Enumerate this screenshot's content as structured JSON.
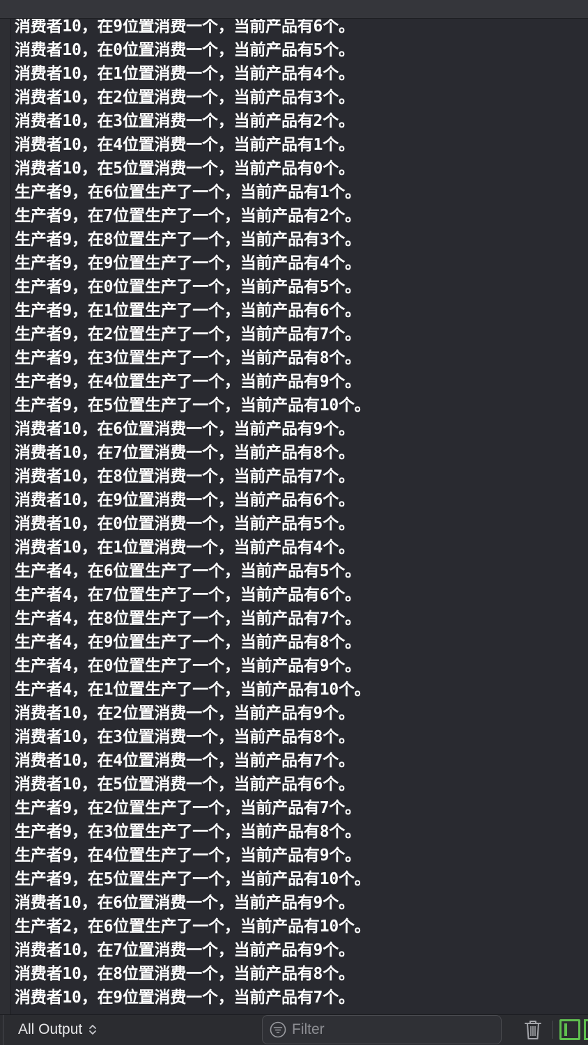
{
  "console": {
    "lines": [
      "消费者10，在9位置消费一个，当前产品有6个。",
      "消费者10，在0位置消费一个，当前产品有5个。",
      "消费者10，在1位置消费一个，当前产品有4个。",
      "消费者10，在2位置消费一个，当前产品有3个。",
      "消费者10，在3位置消费一个，当前产品有2个。",
      "消费者10，在4位置消费一个，当前产品有1个。",
      "消费者10，在5位置消费一个，当前产品有0个。",
      "生产者9，在6位置生产了一个，当前产品有1个。",
      "生产者9，在7位置生产了一个，当前产品有2个。",
      "生产者9，在8位置生产了一个，当前产品有3个。",
      "生产者9，在9位置生产了一个，当前产品有4个。",
      "生产者9，在0位置生产了一个，当前产品有5个。",
      "生产者9，在1位置生产了一个，当前产品有6个。",
      "生产者9，在2位置生产了一个，当前产品有7个。",
      "生产者9，在3位置生产了一个，当前产品有8个。",
      "生产者9，在4位置生产了一个，当前产品有9个。",
      "生产者9，在5位置生产了一个，当前产品有10个。",
      "消费者10，在6位置消费一个，当前产品有9个。",
      "消费者10，在7位置消费一个，当前产品有8个。",
      "消费者10，在8位置消费一个，当前产品有7个。",
      "消费者10，在9位置消费一个，当前产品有6个。",
      "消费者10，在0位置消费一个，当前产品有5个。",
      "消费者10，在1位置消费一个，当前产品有4个。",
      "生产者4，在6位置生产了一个，当前产品有5个。",
      "生产者4，在7位置生产了一个，当前产品有6个。",
      "生产者4，在8位置生产了一个，当前产品有7个。",
      "生产者4，在9位置生产了一个，当前产品有8个。",
      "生产者4，在0位置生产了一个，当前产品有9个。",
      "生产者4，在1位置生产了一个，当前产品有10个。",
      "消费者10，在2位置消费一个，当前产品有9个。",
      "消费者10，在3位置消费一个，当前产品有8个。",
      "消费者10，在4位置消费一个，当前产品有7个。",
      "消费者10，在5位置消费一个，当前产品有6个。",
      "生产者9，在2位置生产了一个，当前产品有7个。",
      "生产者9，在3位置生产了一个，当前产品有8个。",
      "生产者9，在4位置生产了一个，当前产品有9个。",
      "生产者9，在5位置生产了一个，当前产品有10个。",
      "消费者10，在6位置消费一个，当前产品有9个。",
      "生产者2，在6位置生产了一个，当前产品有10个。",
      "消费者10，在7位置消费一个，当前产品有9个。",
      "消费者10，在8位置消费一个，当前产品有8个。",
      "消费者10，在9位置消费一个，当前产品有7个。"
    ]
  },
  "bottombar": {
    "output_label": "All Output",
    "output_icon": "chevron-updown-icon",
    "filter_placeholder": "Filter",
    "filter_value": "",
    "filter_icon": "filter-icon",
    "trash_icon": "trash-icon",
    "panel_toggle_icon": "panel-toggle-icon"
  },
  "colors": {
    "background": "#292a30",
    "text": "#ffffff",
    "accent": "#5fbf4f"
  }
}
